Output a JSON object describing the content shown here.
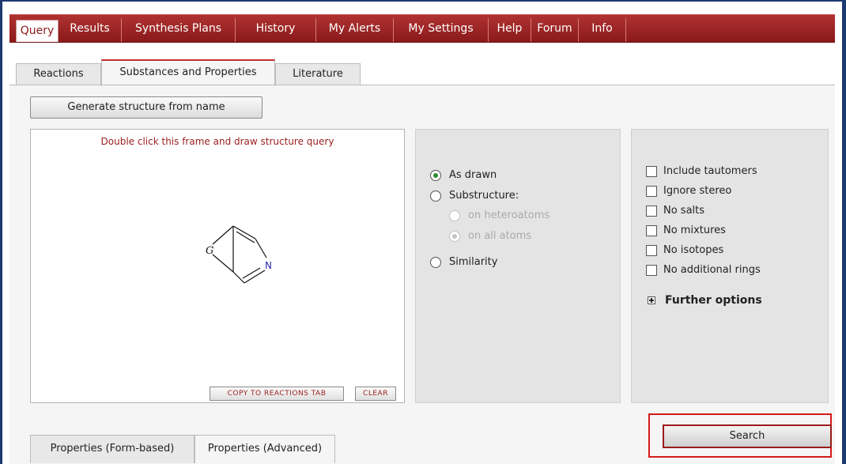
{
  "nav": {
    "tabs": [
      "Query",
      "Results",
      "Synthesis Plans",
      "History",
      "My Alerts",
      "My Settings",
      "Help",
      "Forum",
      "Info"
    ],
    "active": "Query"
  },
  "subtabs": {
    "items": [
      "Reactions",
      "Substances and Properties",
      "Literature"
    ],
    "active": "Substances and Properties"
  },
  "generate_button": "Generate structure from name",
  "structure": {
    "hint": "Double click this frame and draw structure query",
    "atom_g": "G",
    "atom_n": "N",
    "copy_button": "COPY TO REACTIONS TAB",
    "clear_button": "CLEAR"
  },
  "match_options": {
    "as_drawn": "As drawn",
    "substructure": "Substructure:",
    "on_heteroatoms": "on heteroatoms",
    "on_all_atoms": "on all atoms",
    "similarity": "Similarity",
    "selected": "As drawn"
  },
  "filters": {
    "include_tautomers": "Include tautomers",
    "ignore_stereo": "Ignore stereo",
    "no_salts": "No salts",
    "no_mixtures": "No mixtures",
    "no_isotopes": "No isotopes",
    "no_additional_rings": "No additional rings",
    "further_options": "Further options"
  },
  "bottom_tabs": [
    "Properties (Form-based)",
    "Properties (Advanced)"
  ],
  "search_button": "Search",
  "colors": {
    "nav_red": "#a02626",
    "hint_red": "#9b2020",
    "frame_blue": "#1d3a72",
    "highlight_red": "#d41a1a"
  }
}
